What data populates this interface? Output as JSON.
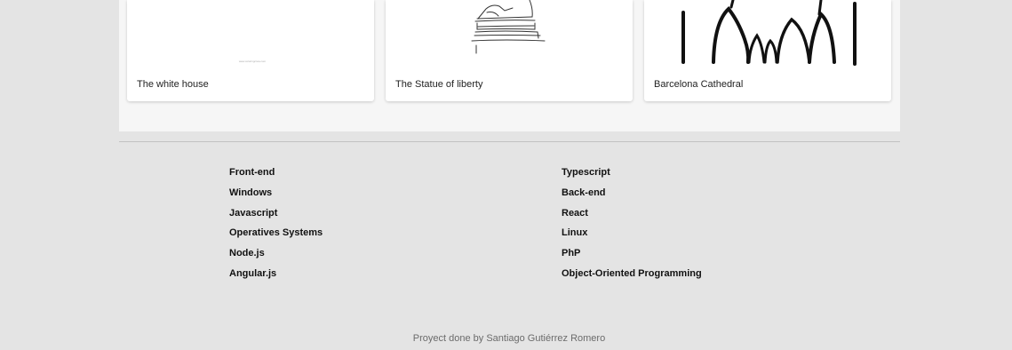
{
  "gallery": {
    "cards": [
      {
        "title": "The white house",
        "caption_small": "www.coloringcrew.com"
      },
      {
        "title": "The Statue of liberty"
      },
      {
        "title": "Barcelona Cathedral"
      }
    ]
  },
  "footer": {
    "left_links": [
      "Front-end",
      "Windows",
      "Javascript",
      "Operatives Systems",
      "Node.js",
      "Angular.js"
    ],
    "right_links": [
      "Typescript",
      "Back-end",
      "React",
      "Linux",
      "PhP",
      "Object-Oriented Programming"
    ],
    "credit": "Proyect done by Santiago Gutiérrez Romero"
  },
  "colors": {
    "page_background": "#e4e4e4",
    "panel_background": "#f6f6f6",
    "card_background": "#ffffff",
    "link_text": "#111111",
    "credit_text": "#6b6b6b"
  }
}
